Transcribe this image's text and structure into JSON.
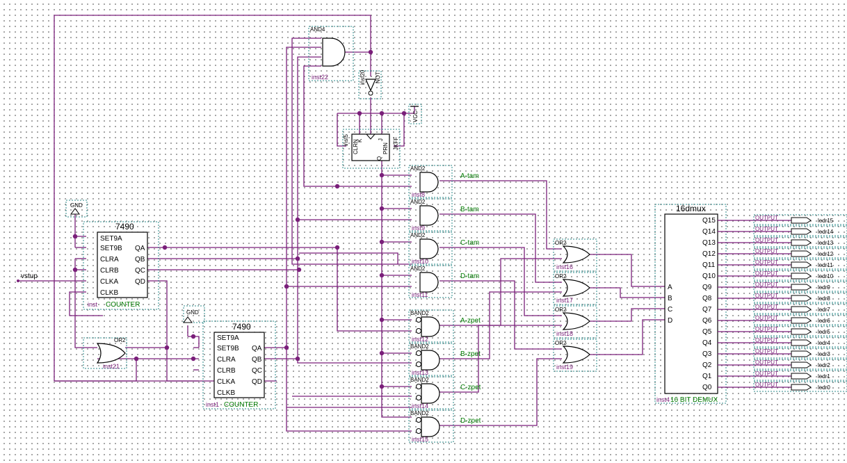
{
  "input": {
    "name": "vstup"
  },
  "ic7490_a": {
    "title": "7490",
    "inst": "inst",
    "type": "COUNTER",
    "pins_in": [
      "SET9A",
      "SET9B",
      "CLRA",
      "CLRB",
      "CLKA",
      "CLKB"
    ],
    "pins_out": [
      "QA",
      "QB",
      "QC",
      "QD"
    ],
    "gnd": "GND"
  },
  "ic7490_b": {
    "title": "7490",
    "inst": "inst1",
    "type": "COUNTER",
    "pins_in": [
      "SET9A",
      "SET9B",
      "CLRA",
      "CLRB",
      "CLKA",
      "CLKB"
    ],
    "pins_out": [
      "QA",
      "QB",
      "QC",
      "QD"
    ],
    "gnd": "GND"
  },
  "and4": {
    "type": "AND4",
    "inst": "inst22"
  },
  "not_gate": {
    "type": "NOT",
    "inst": "inst20"
  },
  "jkff": {
    "inst": "inst5",
    "type": "JKFF",
    "pins": [
      "CLRN",
      "K",
      "J",
      "PRN",
      "Q"
    ],
    "vcc": "VCC"
  },
  "and_gates": [
    {
      "type": "AND2",
      "inst": "inst8",
      "label": "A-tam"
    },
    {
      "type": "AND2",
      "inst": "inst9",
      "label": "B-tam"
    },
    {
      "type": "AND2",
      "inst": "inst10",
      "label": "C-tam"
    },
    {
      "type": "AND2",
      "inst": "inst11",
      "label": "D-tam"
    }
  ],
  "band_gates": [
    {
      "type": "BAND2",
      "inst": "inst12",
      "label": "A-zpet"
    },
    {
      "type": "BAND2",
      "inst": "inst13",
      "label": "B-zpet"
    },
    {
      "type": "BAND2",
      "inst": "inst14",
      "label": "C-zpet"
    },
    {
      "type": "BAND2",
      "inst": "inst15",
      "label": "D-zpet"
    }
  ],
  "or_gates": [
    {
      "type": "OR2",
      "inst": "inst16"
    },
    {
      "type": "OR2",
      "inst": "inst17"
    },
    {
      "type": "OR2",
      "inst": "inst18"
    },
    {
      "type": "OR2",
      "inst": "inst19"
    }
  ],
  "or_gate_21": {
    "type": "OR2",
    "inst": "inst21"
  },
  "demux": {
    "title": "16dmux",
    "inst": "inst4",
    "type": "16 BIT DEMUX",
    "inputs": [
      "A",
      "B",
      "C",
      "D"
    ],
    "outputs": [
      "Q15",
      "Q14",
      "Q13",
      "Q12",
      "Q11",
      "Q10",
      "Q9",
      "Q8",
      "Q7",
      "Q6",
      "Q5",
      "Q4",
      "Q3",
      "Q2",
      "Q1",
      "Q0"
    ]
  },
  "outputs": {
    "pin_type": "OUTPUT",
    "names": [
      "ledr15",
      "ledr14",
      "ledr13",
      "ledr12",
      "ledr11",
      "ledr10",
      "ledr9",
      "ledr8",
      "ledr7",
      "ledr6",
      "ledr5",
      "ledr4",
      "ledr3",
      "ledr2",
      "ledr1",
      "ledr0"
    ]
  }
}
